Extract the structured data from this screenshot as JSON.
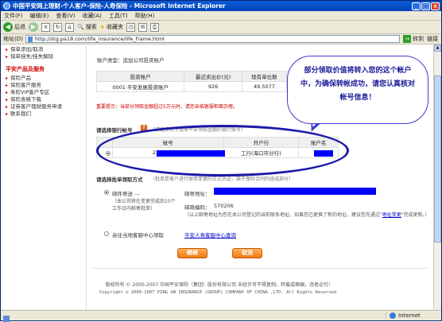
{
  "window": {
    "title": "中国平安网上理财-个人客户-保险-人寿保险 - Microsoft Internet Explorer"
  },
  "menubar": [
    "文件(F)",
    "编辑(E)",
    "查看(V)",
    "收藏(A)",
    "工具(T)",
    "帮助(H)"
  ],
  "toolbar": {
    "back_label": "后退",
    "search_label": "搜索",
    "favorites_label": "收藏夹"
  },
  "address": {
    "label": "地址(D)",
    "url": "http://stg.pa18.com/life_insurance/life_frame.html",
    "go_label": "转到",
    "links_label": "链接"
  },
  "sidebar": {
    "items_top": [
      "保单添加/取消",
      "保单挂失/挂失解除"
    ],
    "heading": "平安产品及服务",
    "items": [
      "保险产品",
      "保险客户服务",
      "寿险VIP客户专区",
      "保险表格下载",
      "证券客户理财服务申请",
      "联系我们"
    ]
  },
  "main": {
    "account_type_label": "账户类型：追加公司投资账户",
    "table": {
      "headers": [
        "投资账户",
        "最近卖出价(元)",
        "现有单位数"
      ],
      "rows": [
        [
          "0001 平安发展投资账户",
          "926",
          "49.5077"
        ]
      ]
    },
    "warning": "重要提示：当部分领取金额超过5万元时，请您亲临客服柜面办理。",
    "bank_section_title": "请选择银行帐号",
    "bank_section_note": "（请选择用于接收平安领取金额的银行账号）",
    "bank_table": {
      "headers": [
        "帐号",
        "开户行",
        "账户名"
      ],
      "rows": [
        {
          "account_prefix": "220",
          "bank": "工行(海口市分行)"
        }
      ]
    },
    "notice_section_title": "请选择批单领取方式",
    "notice_section_note": "（批单是客户进行保单变更的正式凭证，属于保险合同的组成部分）",
    "mail_option_label": "邮件寄送 ---",
    "mail_option_desc": "（本公司将在变更完成后10个工作日内邮寄批单）",
    "mail_address_label": "邮寄地址：",
    "postcode_label": "邮政编码：",
    "postcode_value": "570206",
    "mail_hint": "（以上邮寄地址为您在本公司登记的当前联系地址，如果您已更换了新的地址，建议您先通过\"",
    "mail_hint_link": "地址变更",
    "mail_hint_end": "\"完成更新。）",
    "counter_option_label": "亲往当地客服中心领取",
    "counter_link": "平安人寿客服中心查询",
    "continue_button": "继续",
    "cancel_button": "取消"
  },
  "callout": {
    "text": "部分领取价值将转入您的这个帐户中，为确保转帐成功，请您认真核对帐号信息！"
  },
  "footer": {
    "line1": "版权所有 © 2000-2007 中国平安保险（集团）股份有限公司 未经许可不得复制、转载或摘编，违者必究!",
    "line2": "Copyright © 2000-2007 PING AN INSURANCE (GROUP) COMPANY OF CHINA ,LTD. All Rights Reserved"
  },
  "status": {
    "zone": "Internet"
  }
}
